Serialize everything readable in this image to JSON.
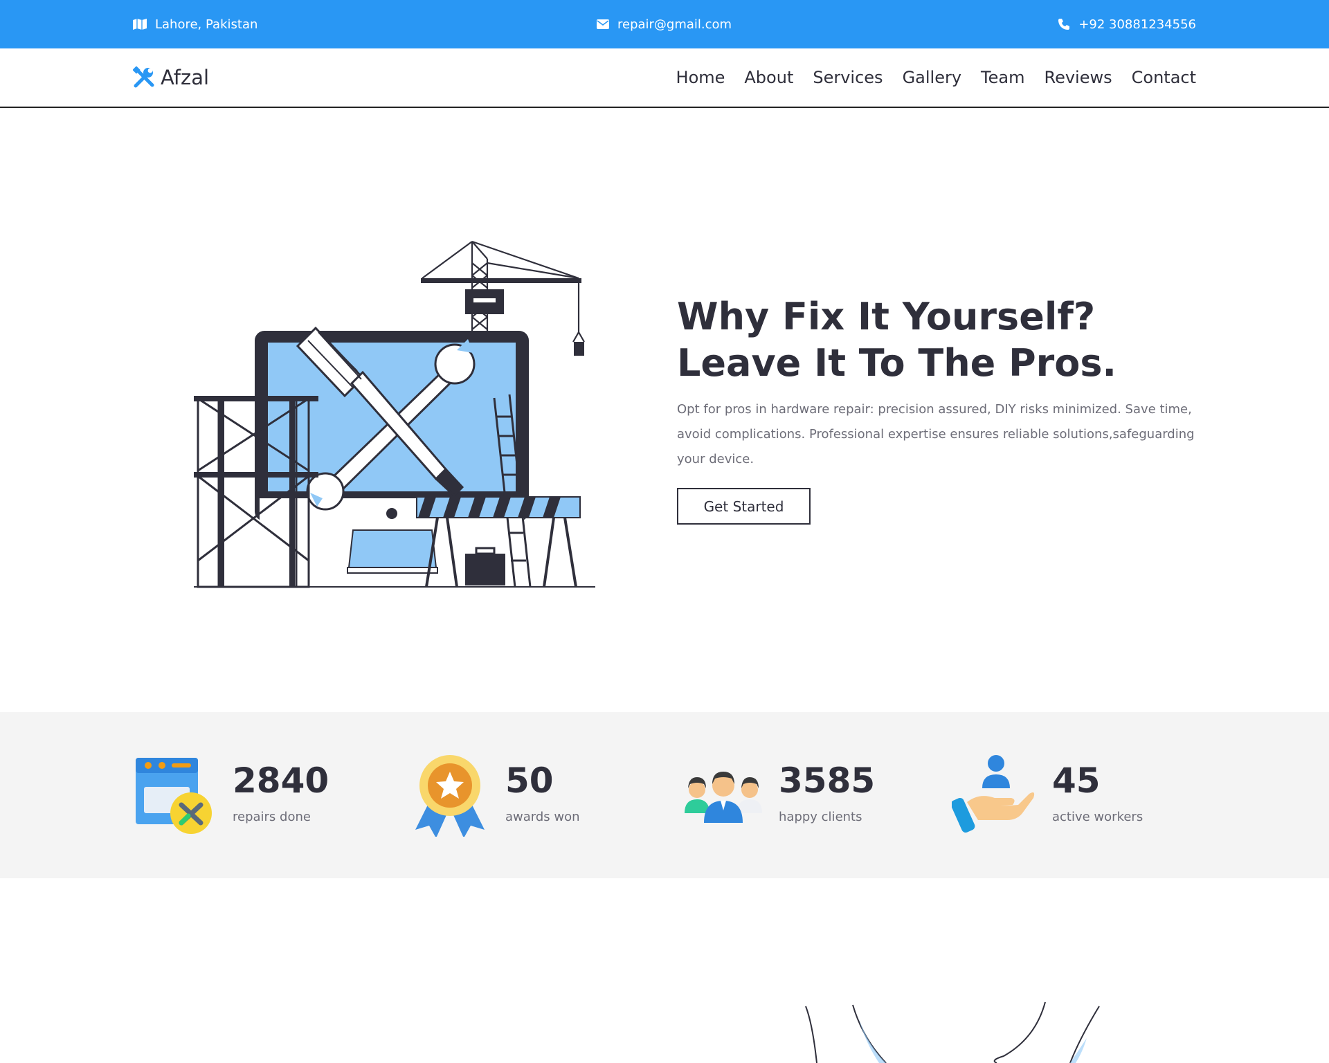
{
  "topbar": {
    "location": "Lahore, Pakistan",
    "email": "repair@gmail.com",
    "phone": "+92 30881234556",
    "location_icon": "map-icon",
    "email_icon": "envelope-icon",
    "phone_icon": "phone-icon"
  },
  "brand": {
    "name": "Afzal",
    "icon": "tools-icon"
  },
  "nav": {
    "items": [
      {
        "label": "Home"
      },
      {
        "label": "About"
      },
      {
        "label": "Services"
      },
      {
        "label": "Gallery"
      },
      {
        "label": "Team"
      },
      {
        "label": "Reviews"
      },
      {
        "label": "Contact"
      }
    ]
  },
  "hero": {
    "title": "Why Fix It Yourself? Leave It To The Pros.",
    "description": "Opt for pros in hardware repair: precision assured, DIY risks minimized. Save time, avoid complications. Professional expertise ensures reliable solutions,safeguarding your device.",
    "cta_label": "Get Started",
    "illustration": "monitor-repair-construction-illustration"
  },
  "stats": [
    {
      "value": "2840",
      "label": "repairs done",
      "icon": "repair-window-icon"
    },
    {
      "value": "50",
      "label": "awards won",
      "icon": "award-medal-icon"
    },
    {
      "value": "3585",
      "label": "happy clients",
      "icon": "clients-group-icon"
    },
    {
      "value": "45",
      "label": "active workers",
      "icon": "worker-hand-icon"
    }
  ],
  "colors": {
    "accent": "#2997f4",
    "text_dark": "#2f2f3b",
    "text_muted": "#6d6d78",
    "stats_bg": "#f4f4f4",
    "screen_blue": "#90c8f6"
  }
}
